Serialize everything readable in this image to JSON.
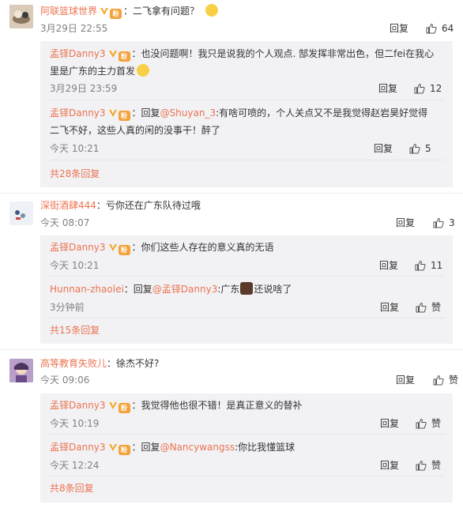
{
  "comments": [
    {
      "user": "阿联篮球世界",
      "text": "：二飞拿有问题？",
      "time": "3月29日 22:55",
      "reply": "回复",
      "likes": "64",
      "subs": [
        {
          "user": "孟铎Danny3",
          "text": "：也没问题啊！我只是说我的个人观点. 郜发挥非常出色，但二fei在我心里是广东的主力首发",
          "time": "3月29日 23:59",
          "reply": "回复",
          "likes": "12"
        },
        {
          "user": "孟铎Danny3",
          "prefix": "：回复",
          "mention": "@Shuyan_3",
          "text": ":有啥可喷的，个人关点又不是我觉得赵岩昊好觉得二飞不好，这些人真的闲的没事干！醉了",
          "time": "今天 10:21",
          "reply": "回复",
          "likes": "5"
        }
      ],
      "more": "共28条回复"
    },
    {
      "user": "深街酒肆444",
      "text": "：亏你还在广东队待过哦",
      "time": "今天 08:07",
      "reply": "回复",
      "likes": "3",
      "subs": [
        {
          "user": "孟铎Danny3",
          "text": "：你们这些人存在的意义真的无语",
          "time": "今天 10:21",
          "reply": "回复",
          "likes": "11"
        },
        {
          "user": "Hunnan-zhaolei",
          "prefix": "：回复",
          "mention": "@孟铎Danny3",
          "text": ":广东",
          "text_after": "还说啥了",
          "time": "3分钟前",
          "reply": "回复",
          "likes": "赞"
        }
      ],
      "more": "共15条回复"
    },
    {
      "user": "高等教育失败儿",
      "text": "：徐杰不好?",
      "time": "今天 09:06",
      "reply": "回复",
      "likes": "赞",
      "subs": [
        {
          "user": "孟铎Danny3",
          "text": "：我觉得他也很不错！是真正意义的替补",
          "time": "今天 10:19",
          "reply": "回复",
          "likes": "赞"
        },
        {
          "user": "孟铎Danny3",
          "prefix": "：回复",
          "mention": "@Nancywangss",
          "text": ":你比我懂篮球",
          "time": "今天 12:24",
          "reply": "回复",
          "likes": "赞"
        }
      ],
      "more": "共8条回复"
    }
  ],
  "colors": {
    "username": "#eb7350",
    "sub_bg": "#f2f2f5",
    "time": "#808080",
    "vbadge": "#f5a623"
  },
  "icons": {
    "verified": "verified-v-icon",
    "medal": "fan-medal-icon",
    "like": "thumbs-up-icon",
    "emoji": "emoji-icon"
  }
}
